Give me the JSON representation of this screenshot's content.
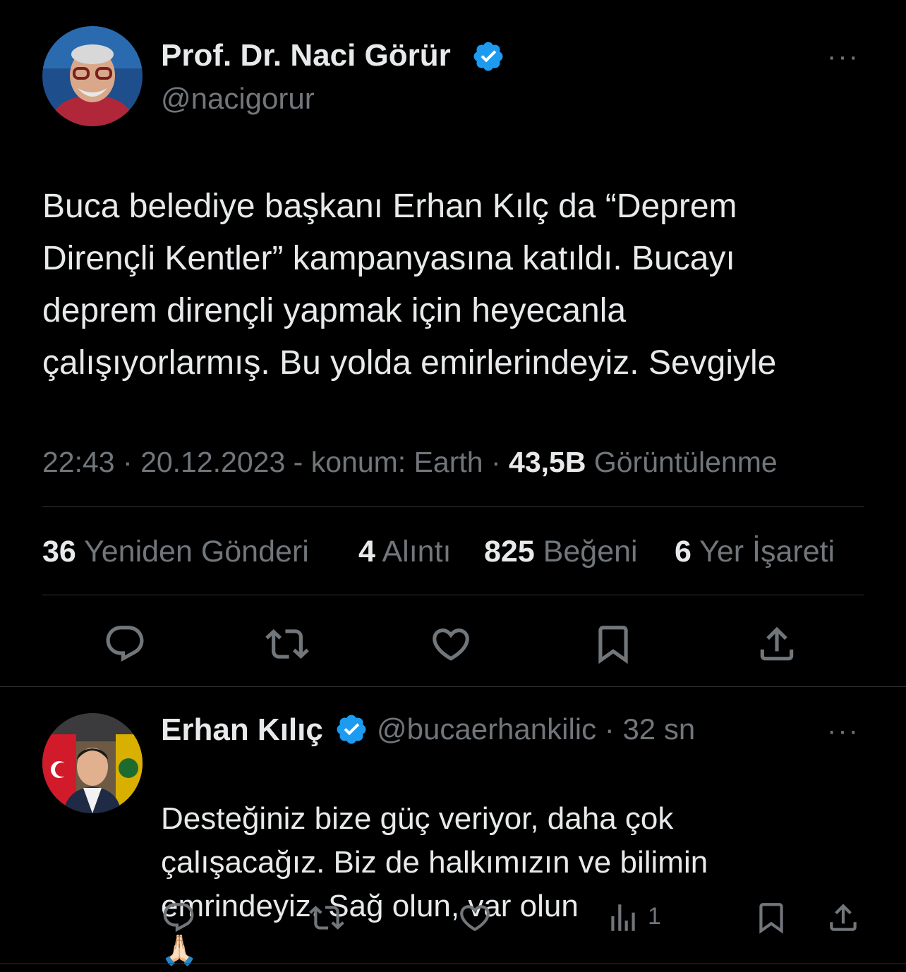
{
  "tweet": {
    "author_name": "Prof. Dr. Naci Görür",
    "author_handle": "@nacigorur",
    "more_label": "···",
    "text": "Buca belediye başkanı Erhan Kılç da “Deprem\nDirençli Kentler” kampanyasına katıldı. Bucayı\ndeprem dirençli yapmak için heyecanla\nçalışıyorlarmış. Bu yolda emirlerindeyiz. Sevgiyle",
    "time": "22:43",
    "date": "20.12.2023",
    "location": "konum: Earth",
    "views_count": "43,5B",
    "views_label": "Görüntülenme",
    "stats": {
      "retweets_count": "36",
      "retweets_label": "Yeniden Gönderi",
      "quotes_count": "4",
      "quotes_label": "Alıntı",
      "likes_count": "825",
      "likes_label": "Beğeni",
      "bookmarks_count": "6",
      "bookmarks_label": "Yer İşareti"
    }
  },
  "reply": {
    "author_name": "Erhan Kılıç",
    "author_handle": "@bucaerhankilic",
    "time_ago": "32 sn",
    "more_label": "···",
    "text": "Desteğiniz bize güç veriyor, daha çok\nçalışacağız. Biz de halkımızın ve bilimin\nemrindeyiz. Sağ olun, var olun",
    "emoji": "🙏🏻",
    "views_count": "1"
  },
  "colors": {
    "background": "#000000",
    "text_primary": "#e7e9ea",
    "text_secondary": "#71767b",
    "divider": "#2f3336",
    "verified": "#1d9bf0"
  },
  "icons": [
    "verified-badge-icon",
    "more-icon",
    "reply-icon",
    "retweet-icon",
    "like-icon",
    "bookmark-icon",
    "share-icon",
    "views-icon"
  ]
}
